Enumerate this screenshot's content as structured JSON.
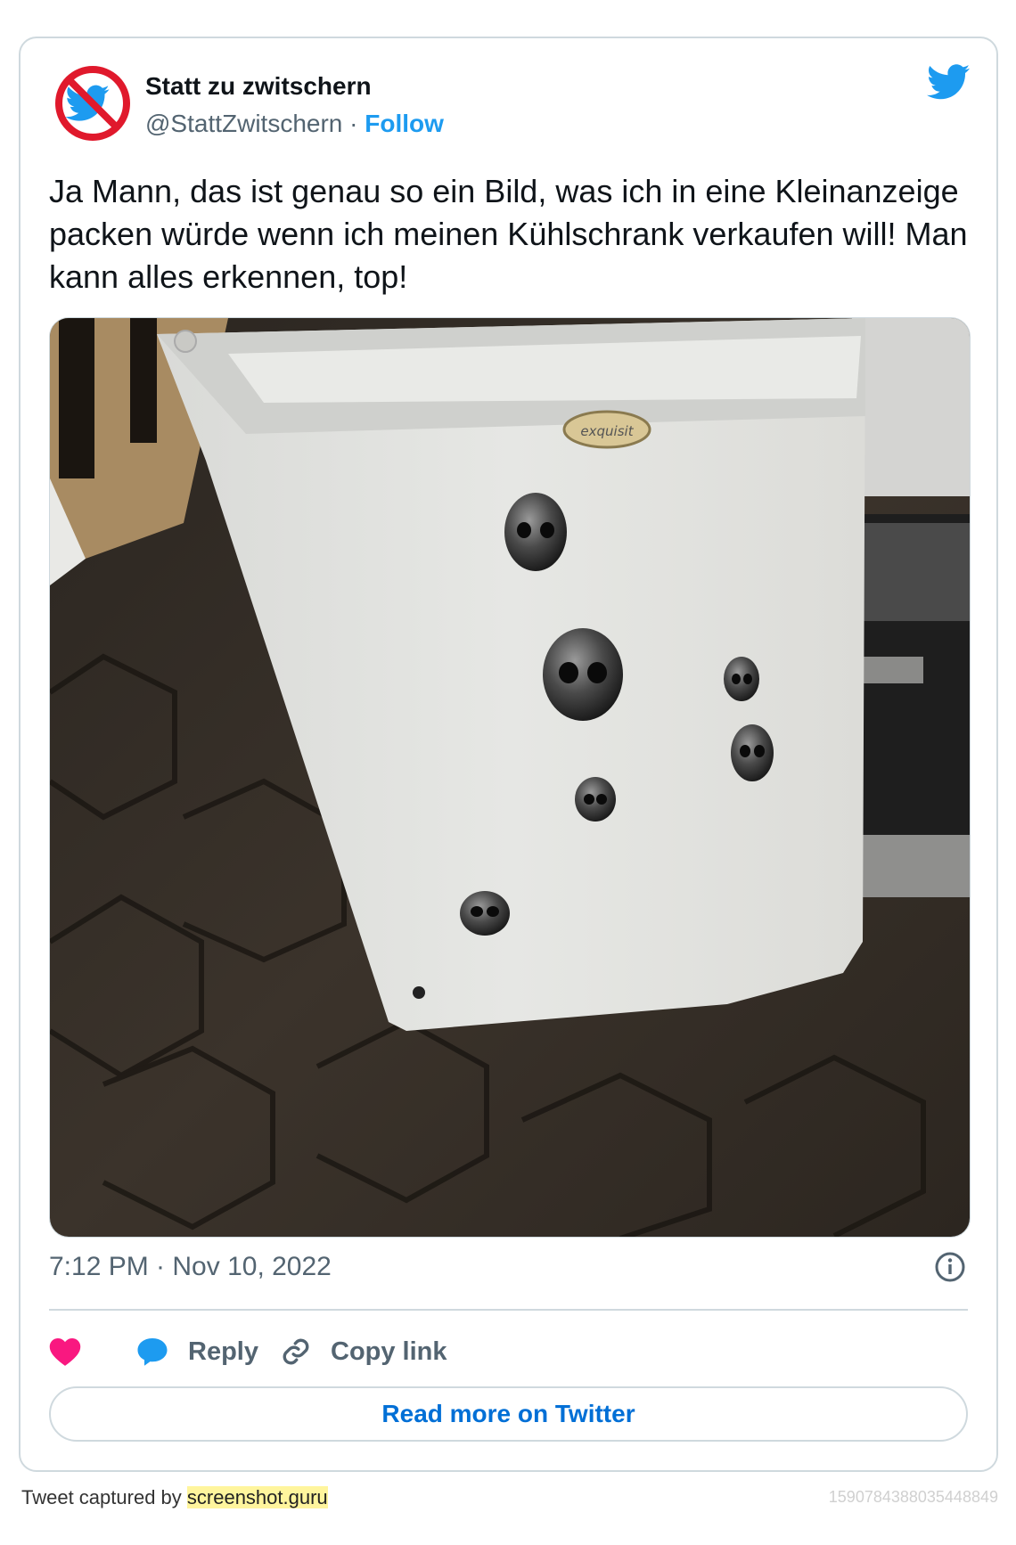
{
  "user": {
    "name": "Statt zu zwitschern",
    "handle": "@StattZwitschern",
    "separator": " · ",
    "follow_label": "Follow"
  },
  "tweet": {
    "text": "Ja Mann, das ist genau so ein Bild, was ich in eine Kleinanzeige packen würde wenn ich meinen Kühlschrank verkaufen will! Man kann alles erkennen, top!",
    "timestamp": "7:12 PM · Nov 10, 2022",
    "photo_brand_label": "exquisit"
  },
  "actions": {
    "like_icon": "heart-icon",
    "reply_label": "Reply",
    "copy_link_label": "Copy link"
  },
  "read_more_label": "Read more on Twitter",
  "footer": {
    "captured_prefix": "Tweet captured by ",
    "captured_link": "screenshot.guru",
    "tweet_id": "1590784388035448849"
  },
  "colors": {
    "accent_blue": "#1d9bf0",
    "link_blue": "#006fd6",
    "like_pink": "#f91880",
    "muted_text": "#536471",
    "border": "#cfd9de"
  }
}
